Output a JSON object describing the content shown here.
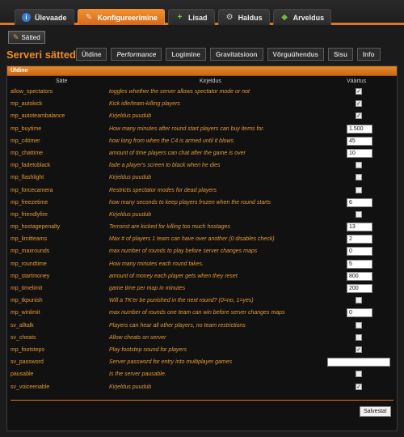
{
  "nav": {
    "tabs": [
      {
        "label": "Ülevaade",
        "icon": "info-icon"
      },
      {
        "label": "Konfigureerimine",
        "icon": "wrench-icon"
      },
      {
        "label": "Lisad",
        "icon": "plus-icon"
      },
      {
        "label": "Haldus",
        "icon": "gear-icon"
      },
      {
        "label": "Arveldus",
        "icon": "money-icon"
      }
    ],
    "active": "Konfigureerimine"
  },
  "toolbar": {
    "satted_label": "Sätted"
  },
  "page": {
    "title": "Serveri sätted"
  },
  "subtabs": [
    "Üldine",
    "Performance",
    "Logimine",
    "Gravitatsioon",
    "Võrguühendus",
    "Sisu",
    "Info"
  ],
  "panel": {
    "title": "Üldine",
    "columns": {
      "name": "Säte",
      "desc": "Kirjeldus",
      "value": "Väärtus"
    },
    "rows": [
      {
        "name": "allow_spectators",
        "desc": "toggles whether the server allows spectator mode or not",
        "type": "check",
        "checked": true
      },
      {
        "name": "mp_autokick",
        "desc": "Kick idle/team-killing players",
        "type": "check",
        "checked": true
      },
      {
        "name": "mp_autoteambalance",
        "desc": "Kirjeldus puudub",
        "type": "check",
        "checked": true
      },
      {
        "name": "mp_buytime",
        "desc": "How many minutes after round start players can buy items for.",
        "type": "input",
        "value": "1.500"
      },
      {
        "name": "mp_c4timer",
        "desc": "how long from when the C4 is armed until it blows",
        "type": "input",
        "value": "45"
      },
      {
        "name": "mp_chattime",
        "desc": "amount of time players can chat after the game is over",
        "type": "input",
        "value": "10"
      },
      {
        "name": "mp_fadetoblack",
        "desc": "fade a player's screen to black when he dies",
        "type": "check",
        "checked": false
      },
      {
        "name": "mp_flashlight",
        "desc": "Kirjeldus puudub",
        "type": "check",
        "checked": false
      },
      {
        "name": "mp_forcecamera",
        "desc": "Restricts spectator modes for dead players",
        "type": "check",
        "checked": false
      },
      {
        "name": "mp_freezetime",
        "desc": "how many seconds to keep players frozen when the round starts",
        "type": "input",
        "value": "6"
      },
      {
        "name": "mp_friendlyfire",
        "desc": "Kirjeldus puudub",
        "type": "check",
        "checked": false
      },
      {
        "name": "mp_hostagepenalty",
        "desc": "Terrorist are kicked for killing too much hostages",
        "type": "input",
        "value": "13"
      },
      {
        "name": "mp_limitteams",
        "desc": "Max # of players 1 team can have over another (0 disables check)",
        "type": "input",
        "value": "2"
      },
      {
        "name": "mp_maxrounds",
        "desc": "max number of rounds to play before server changes maps",
        "type": "input",
        "value": "0"
      },
      {
        "name": "mp_roundtime",
        "desc": "How many minutes each round takes.",
        "type": "input",
        "value": "5"
      },
      {
        "name": "mp_startmoney",
        "desc": "amount of money each player gets when they reset",
        "type": "input",
        "value": "800"
      },
      {
        "name": "mp_timelimit",
        "desc": "game time per map in minutes",
        "type": "input",
        "value": "200"
      },
      {
        "name": "mp_tkpunish",
        "desc": "Will a TK'er be punished in the next round? (0=no, 1=yes)",
        "type": "check",
        "checked": false
      },
      {
        "name": "mp_winlimit",
        "desc": "max number of rounds one team can win before server changes maps",
        "type": "input",
        "value": "0"
      },
      {
        "name": "sv_alltalk",
        "desc": "Players can hear all other players, no team restrictions",
        "type": "check",
        "checked": false
      },
      {
        "name": "sv_cheats",
        "desc": "Allow cheats on server",
        "type": "check",
        "checked": false
      },
      {
        "name": "mp_footsteps",
        "desc": "Play footstep sound for players",
        "type": "check",
        "checked": true
      },
      {
        "name": "sv_password",
        "desc": "Server password for entry into multiplayer games",
        "type": "wide",
        "value": ""
      },
      {
        "name": "pausable",
        "desc": "Is the server pausable.",
        "type": "check",
        "checked": false
      },
      {
        "name": "sv_voiceenable",
        "desc": "Kirjeldus puudub",
        "type": "check",
        "checked": true
      }
    ],
    "save_label": "Salvesta!"
  },
  "colors": {
    "accent": "#e0761d",
    "text_orange": "#e49a30"
  }
}
